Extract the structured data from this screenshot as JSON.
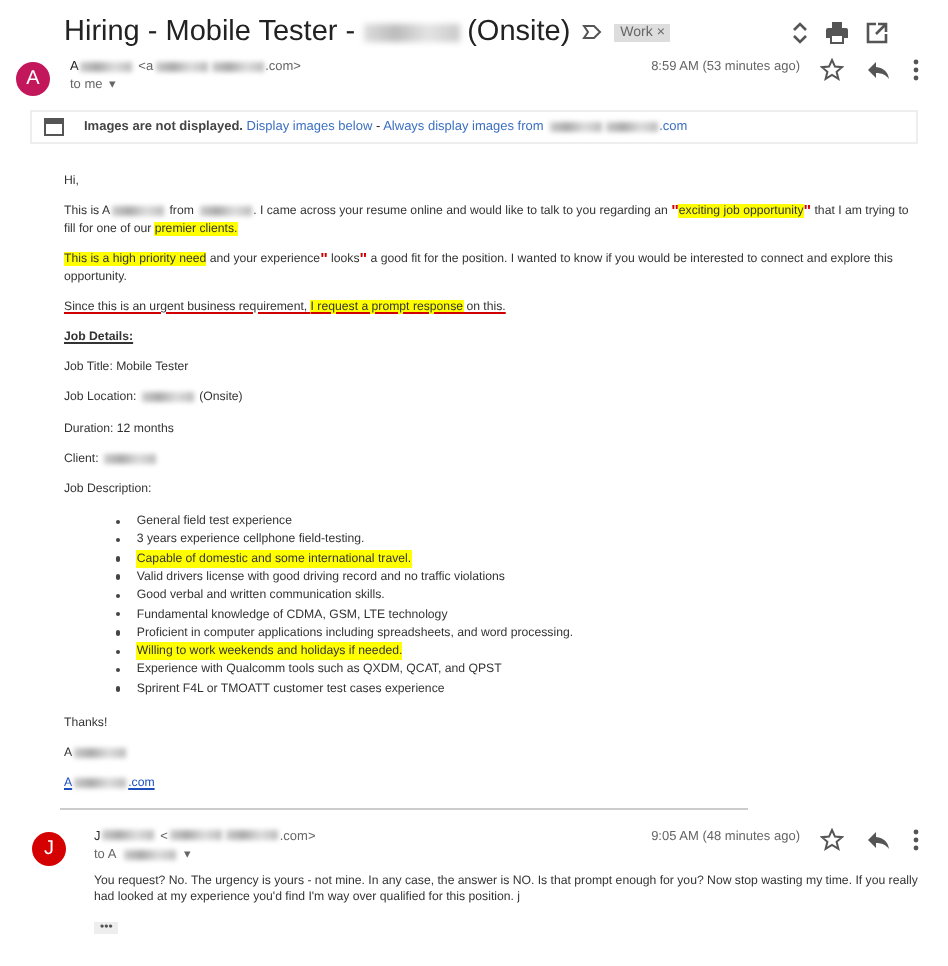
{
  "subject": {
    "title_start": "Hiring - Mobile Tester - ",
    "title_end": "(Onsite)",
    "label": "Work",
    "label_close": "×"
  },
  "messages": [
    {
      "avatar": "A",
      "color": "#c2185b",
      "sender": "A",
      "email_start": "<a",
      "email_end": ".com>",
      "recipient": "to me",
      "caret": "▾",
      "time": "8:59 AM (53 minutes ago)",
      "images_notice": {
        "bold": "Images are not displayed.",
        "show_link": "Display images below",
        "separator": " - ",
        "always_start": "Always display images from ",
        "always_end": ".com"
      },
      "body": [
        {
          "kind": "p",
          "segments": [
            {
              "kind": "text",
              "text": "Hi,"
            }
          ]
        },
        {
          "kind": "p",
          "segments": [
            {
              "kind": "text",
              "text": "This is A"
            },
            {
              "kind": "redacted"
            },
            {
              "kind": "text",
              "text": " from "
            },
            {
              "kind": "redacted"
            },
            {
              "kind": "text",
              "text": ". I came across your resume online and would like to talk to you regarding an "
            },
            {
              "kind": "quote",
              "text": "\""
            },
            {
              "kind": "text",
              "text": "exciting job opportunity",
              "highlight": true
            },
            {
              "kind": "quote",
              "text": "\""
            },
            {
              "kind": "text",
              "text": " that I am trying to fill for one of our "
            },
            {
              "kind": "text",
              "text": "premier clients.",
              "highlight": true
            }
          ]
        },
        {
          "kind": "p",
          "segments": [
            {
              "kind": "text",
              "text": "This is a high priority need",
              "highlight": true
            },
            {
              "kind": "text",
              "text": " and your experience"
            },
            {
              "kind": "quote",
              "text": "\""
            },
            {
              "kind": "text",
              "text": " looks"
            },
            {
              "kind": "quote",
              "text": "\""
            },
            {
              "kind": "text",
              "text": " a good fit for the position. I wanted to know if you would be interested to connect and explore this opportunity."
            }
          ]
        },
        {
          "kind": "p",
          "segments": [
            {
              "kind": "text",
              "text": "Since this is an urgent business requirement, ",
              "underline": true
            },
            {
              "kind": "text",
              "text": "I request a prompt response",
              "highlight": true,
              "underline": true
            },
            {
              "kind": "text",
              "text": " on this.",
              "underline": true
            }
          ]
        },
        {
          "kind": "heading",
          "segments": [
            {
              "kind": "text",
              "text": "Job Details:"
            }
          ]
        },
        {
          "kind": "p",
          "segments": [
            {
              "kind": "text",
              "text": "Job Title: Mobile Tester"
            }
          ]
        },
        {
          "kind": "p",
          "segments": [
            {
              "kind": "text",
              "text": "Job Location: "
            },
            {
              "kind": "redacted"
            },
            {
              "kind": "text",
              "text": " (Onsite)"
            }
          ]
        },
        {
          "kind": "p",
          "segments": [
            {
              "kind": "text",
              "text": "Duration: 12 months"
            }
          ]
        },
        {
          "kind": "p",
          "segments": [
            {
              "kind": "text",
              "text": "Client: "
            },
            {
              "kind": "redacted"
            }
          ]
        },
        {
          "kind": "p",
          "segments": [
            {
              "kind": "text",
              "text": "Job Description:"
            }
          ]
        },
        {
          "kind": "bullets",
          "items": [
            {
              "text": "General field test experience",
              "highlight": false
            },
            {
              "text": "3 years experience cellphone field-testing.",
              "highlight": false
            },
            {
              "text": "Capable of domestic and some international travel.",
              "highlight": true
            },
            {
              "text": "Valid drivers license with good driving record and no traffic violations",
              "highlight": false
            },
            {
              "text": "Good verbal and written communication skills.",
              "highlight": false
            },
            {
              "text": "Fundamental knowledge of CDMA, GSM, LTE technology",
              "highlight": false
            },
            {
              "text": "Proficient in computer applications including spreadsheets, and word processing.",
              "highlight": false
            },
            {
              "text": "Willing to work weekends and holidays if needed.",
              "highlight": true
            },
            {
              "text": "Experience with Qualcomm tools such as QXDM, QCAT, and QPST",
              "highlight": false
            },
            {
              "text": "Sprirent F4L or TMOATT customer test cases experience",
              "highlight": false
            }
          ]
        },
        {
          "kind": "p",
          "segments": [
            {
              "kind": "text",
              "text": "Thanks!"
            }
          ]
        },
        {
          "kind": "p",
          "segments": [
            {
              "kind": "text",
              "text": "A"
            },
            {
              "kind": "redacted"
            }
          ]
        },
        {
          "kind": "link",
          "segments": [
            {
              "kind": "text",
              "text": "A"
            },
            {
              "kind": "redacted"
            },
            {
              "kind": "text",
              "text": ".com"
            }
          ]
        }
      ]
    },
    {
      "avatar": "J",
      "color": "#d50000",
      "sender": "J",
      "email_start": "<",
      "email_end": ".com>",
      "recipient": "to A",
      "caret": "▾",
      "time": "9:05 AM (48 minutes ago)",
      "body": [
        {
          "kind": "p",
          "segments": [
            {
              "kind": "text",
              "text": "You request? No. The urgency is yours - not mine. In any case, the answer is NO. Is that prompt enough for you? Now stop wasting my time. If you really had looked at my experience you'd find I'm way over qualified for this position. j"
            }
          ]
        }
      ],
      "trimmed": "•••"
    }
  ]
}
